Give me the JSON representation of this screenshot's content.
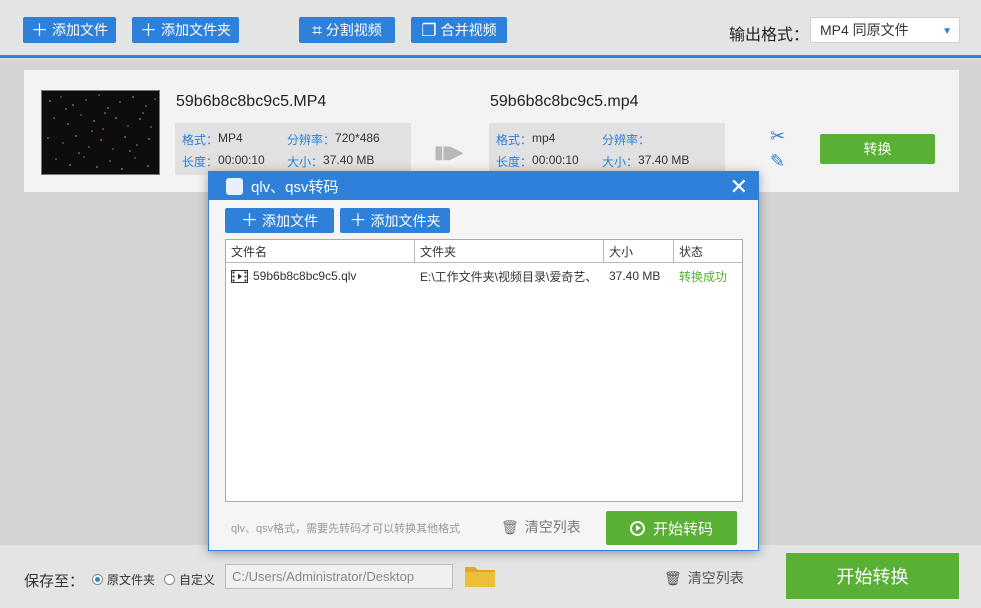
{
  "toolbar": {
    "add_file": "添加文件",
    "add_folder": "添加文件夹",
    "split_video": "分割视频",
    "merge_video": "合并视频",
    "output_format_label": "输出格式：",
    "output_format_value": "MP4  同原文件"
  },
  "item": {
    "source_name": "59b6b8c8bc9c5.MP4",
    "target_name": "59b6b8c8bc9c5.mp4",
    "source": {
      "format_label": "格式：",
      "format": "MP4",
      "resolution_label": "分辨率：",
      "resolution": "720*486",
      "duration_label": "长度：",
      "duration": "00:00:10",
      "size_label": "大小：",
      "size": "37.40 MB"
    },
    "target": {
      "format_label": "格式：",
      "format": "mp4",
      "resolution_label": "分辨率：",
      "resolution": "",
      "duration_label": "长度：",
      "duration": "00:00:10",
      "size_label": "大小：",
      "size": "37.40 MB"
    },
    "convert_button": "转换"
  },
  "dialog": {
    "title": "qlv、qsv转码",
    "add_file": "添加文件",
    "add_folder": "添加文件夹",
    "columns": [
      "文件名",
      "文件夹",
      "大小",
      "状态"
    ],
    "rows": [
      {
        "name": "59b6b8c8bc9c5.qlv",
        "folder": "E:\\工作文件夹\\视频目录\\爱奇艺、",
        "size": "37.40 MB",
        "status": "转换成功"
      }
    ],
    "hint": "qlv、qsv格式，需要先转码才可以转换其他格式",
    "clear_list": "清空列表",
    "start": "开始转码"
  },
  "bottom": {
    "save_to_label": "保存至：",
    "radio_original": "原文件夹",
    "radio_custom": "自定义",
    "path": "C:/Users/Administrator/Desktop",
    "clear_list": "清空列表",
    "start": "开始转换"
  },
  "colors": {
    "accent": "#2f80d8",
    "success": "#5aaf35"
  }
}
